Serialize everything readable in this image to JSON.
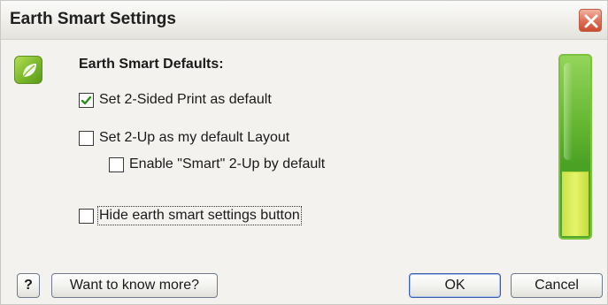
{
  "window": {
    "title": "Earth Smart Settings"
  },
  "icons": {
    "app": "leaf-icon",
    "close": "close-icon",
    "check": "check-icon"
  },
  "settings": {
    "heading": "Earth Smart Defaults:",
    "options": [
      {
        "label": "Set 2-Sided Print as default",
        "checked": true
      },
      {
        "label": "Set 2-Up as my default Layout",
        "checked": false
      },
      {
        "label": "Enable \"Smart\" 2-Up by default",
        "checked": false
      },
      {
        "label": "Hide earth smart settings button",
        "checked": false
      }
    ]
  },
  "savings_meter": {
    "level": 0.36,
    "colors": {
      "frame": "#7cc23d",
      "fill": "#e6f36a"
    }
  },
  "buttons": {
    "help": "?",
    "know_more": "Want to know more?",
    "ok": "OK",
    "cancel": "Cancel"
  }
}
